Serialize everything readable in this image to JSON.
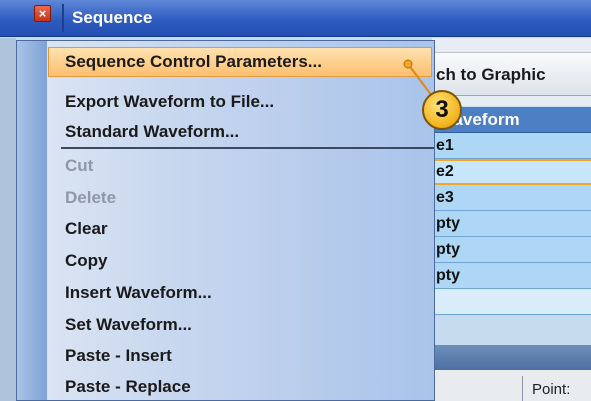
{
  "window": {
    "title": "Sequence",
    "close_symbol": "×"
  },
  "switch_button": {
    "label": "ch to Graphic"
  },
  "grid": {
    "header": "Waveform",
    "rows": [
      "e1",
      "e2",
      "e3",
      "pty",
      "pty",
      "pty",
      ""
    ],
    "selected_row_index": 1
  },
  "status": {
    "point_label": "Point:"
  },
  "menu": {
    "items": [
      {
        "label": "Sequence Control Parameters...",
        "enabled": true,
        "highlighted": true
      },
      {
        "label": "Export Waveform to File...",
        "enabled": true
      },
      {
        "label": "Standard Waveform...",
        "enabled": true
      },
      {
        "label": "Cut",
        "enabled": false
      },
      {
        "label": "Delete",
        "enabled": false
      },
      {
        "label": "Clear",
        "enabled": true
      },
      {
        "label": "Copy",
        "enabled": true
      },
      {
        "label": "Insert Waveform...",
        "enabled": true
      },
      {
        "label": "Set Waveform...",
        "enabled": true
      },
      {
        "label": "Paste - Insert",
        "enabled": true
      },
      {
        "label": "Paste - Replace",
        "enabled": true
      }
    ]
  },
  "callout": {
    "number": "3"
  },
  "colors": {
    "title_bar": "#2f5cc0",
    "highlight": "#fdbf6f",
    "highlight_border": "#e29a3a",
    "grid_header": "#4d7fc5",
    "grid_row": "#aed7f5",
    "disabled_text": "#8f98a6",
    "callout": "#f2b21a"
  },
  "icons": {
    "close": "close-icon",
    "callout_pointer": "callout-pointer-icon"
  }
}
